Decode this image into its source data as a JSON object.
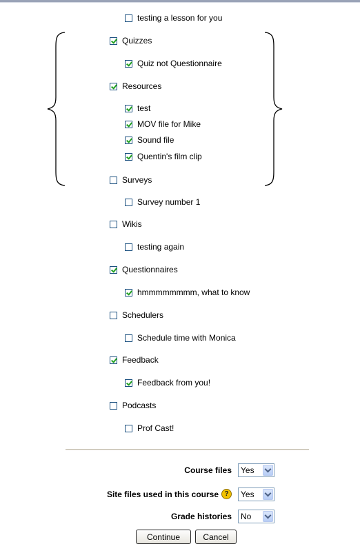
{
  "items": [
    {
      "label": "testing a lesson for you",
      "checked": false,
      "level": 2
    },
    {
      "label": "Quizzes",
      "checked": true,
      "level": 1
    },
    {
      "label": "Quiz not Questionnaire",
      "checked": true,
      "level": 2
    },
    {
      "label": "Resources",
      "checked": true,
      "level": 1
    },
    {
      "label": "test",
      "checked": true,
      "level": 2
    },
    {
      "label": "MOV file for Mike",
      "checked": true,
      "level": 2
    },
    {
      "label": "Sound file",
      "checked": true,
      "level": 2
    },
    {
      "label": "Quentin's film clip",
      "checked": true,
      "level": 2
    },
    {
      "label": "Surveys",
      "checked": false,
      "level": 1
    },
    {
      "label": "Survey number 1",
      "checked": false,
      "level": 2
    },
    {
      "label": "Wikis",
      "checked": false,
      "level": 1
    },
    {
      "label": "testing again",
      "checked": false,
      "level": 2
    },
    {
      "label": "Questionnaires",
      "checked": true,
      "level": 1
    },
    {
      "label": "hmmmmmmmm, what to know",
      "checked": true,
      "level": 2
    },
    {
      "label": "Schedulers",
      "checked": false,
      "level": 1
    },
    {
      "label": "Schedule time with Monica",
      "checked": false,
      "level": 2
    },
    {
      "label": "Feedback",
      "checked": true,
      "level": 1
    },
    {
      "label": "Feedback from you!",
      "checked": true,
      "level": 2
    },
    {
      "label": "Podcasts",
      "checked": false,
      "level": 1
    },
    {
      "label": "Prof Cast!",
      "checked": false,
      "level": 2
    }
  ],
  "options": {
    "course_files": {
      "label": "Course files",
      "value": "Yes"
    },
    "site_files": {
      "label": "Site files used in this course",
      "value": "Yes",
      "help_icon": "help-icon"
    },
    "grade_histories": {
      "label": "Grade histories",
      "value": "No"
    }
  },
  "buttons": {
    "continue": "Continue",
    "cancel": "Cancel"
  },
  "colors": {
    "checkbox_border": "#1c5180",
    "checkmark": "#21a121",
    "help_icon": "#f2c200"
  }
}
